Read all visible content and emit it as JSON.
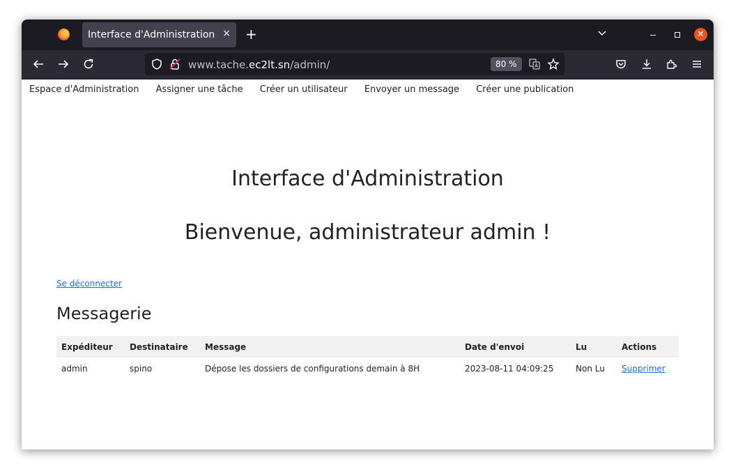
{
  "browser": {
    "tab_title": "Interface d'Administration",
    "tab_close": "×",
    "new_tab": "+",
    "url_prefix": "www.tache.",
    "url_host": "ec2lt.sn",
    "url_path": "/admin/",
    "zoom": "80 %",
    "close_glyph": "✕"
  },
  "nav": [
    "Espace d'Administration",
    "Assigner une tâche",
    "Créer un utilisateur",
    "Envoyer un message",
    "Créer une publication"
  ],
  "page": {
    "title": "Interface d'Administration",
    "welcome": "Bienvenue, administrateur admin !",
    "logout": "Se déconnecter",
    "section_title": "Messagerie"
  },
  "table": {
    "headers": [
      "Expéditeur",
      "Destinataire",
      "Message",
      "Date d'envoi",
      "Lu",
      "Actions"
    ],
    "rows": [
      {
        "sender": "admin",
        "recipient": "spino",
        "message": "Dépose les dossiers de configurations demain à 8H",
        "date": "2023-08-11 04:09:25",
        "read": "Non Lu",
        "action": "Supprimer"
      }
    ]
  },
  "colors": {
    "link": "#1f6fd6",
    "header_bg": "#f1f1f1",
    "window_close": "#e95420"
  }
}
